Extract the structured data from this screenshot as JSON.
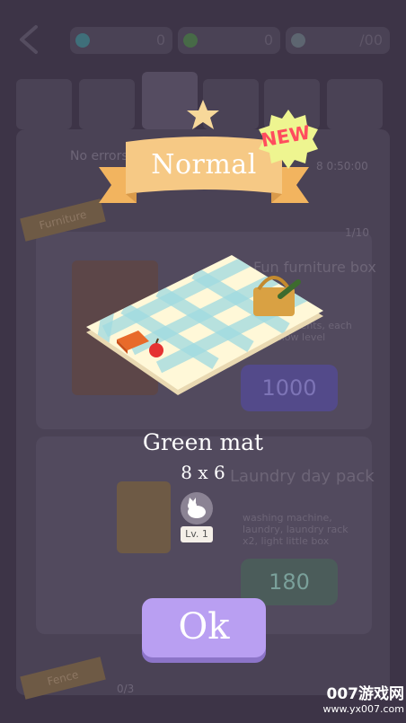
{
  "background": {
    "currencies": [
      {
        "value": "0",
        "color": "#3f8fa0"
      },
      {
        "value": "0",
        "color": "#4a8a4a"
      },
      {
        "value": "/00",
        "color": "#6d7a88"
      }
    ],
    "notice_left": "No errors",
    "notice_right": "8 0:50:00",
    "counter": "1/10",
    "card1_title": "Fun furniture box",
    "card1_desc": "...contents, each below level",
    "card1_price": "1000",
    "card2_title": "Laundry day pack",
    "card2_desc": "washing machine, laundry, laundry rack x2, light little box",
    "card2_price": "180",
    "tag1": "Furniture",
    "tag2": "Fence",
    "bottom_left": "0/3"
  },
  "popup": {
    "rarity": "Normal",
    "badge": "NEW",
    "item_name": "Green mat",
    "item_size": "8 x 6",
    "level_label": "Lv. 1",
    "ok_label": "Ok"
  },
  "watermark": {
    "line1": "007游戏网",
    "line2": "www.yx007.com"
  },
  "colors": {
    "ok_button": "#b99ff2",
    "banner": "#f6c985",
    "badge_bg": "#eef590",
    "badge_text": "#ff4d5e",
    "mat_base": "#fff8d8",
    "mat_stripe": "#9fd9e0"
  }
}
